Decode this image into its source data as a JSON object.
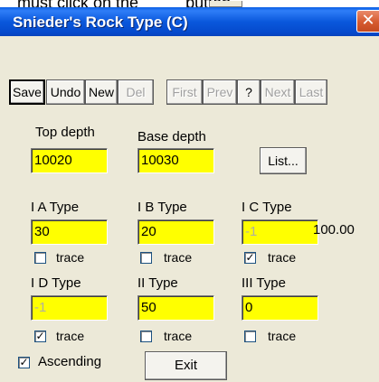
{
  "doc_strip": {
    "text": "must click on the",
    "after_text": "button,"
  },
  "window": {
    "title": "Snieder's Rock Type (C)",
    "close_glyph": "✕"
  },
  "toolbar": {
    "save": "Save",
    "undo": "Undo",
    "new": "New",
    "del": "Del",
    "first": "First",
    "prev": "Prev",
    "help": "?",
    "next": "Next",
    "last": "Last"
  },
  "depth": {
    "top_label": "Top depth",
    "top_value": "10020",
    "base_label": "Base depth",
    "base_value": "10030",
    "list_button": "List..."
  },
  "types": [
    {
      "label": "I A Type",
      "value": "30",
      "disabled": false,
      "trace_checked": false
    },
    {
      "label": "I B Type",
      "value": "20",
      "disabled": false,
      "trace_checked": false
    },
    {
      "label": "I C Type",
      "value": "-1",
      "disabled": true,
      "trace_checked": true
    },
    {
      "label": "I D Type",
      "value": "-1",
      "disabled": true,
      "trace_checked": true
    },
    {
      "label": "II Type",
      "value": "50",
      "disabled": false,
      "trace_checked": false
    },
    {
      "label": "III Type",
      "value": "0",
      "disabled": false,
      "trace_checked": false
    }
  ],
  "trace_label": "trace",
  "total_value": "100.00",
  "ascending": {
    "label": "Ascending",
    "checked": true
  },
  "exit_button": "Exit",
  "colors": {
    "titlebar": "#0a5fe4",
    "field_bg": "#ffff00",
    "dialog_bg": "#ece9d8"
  }
}
